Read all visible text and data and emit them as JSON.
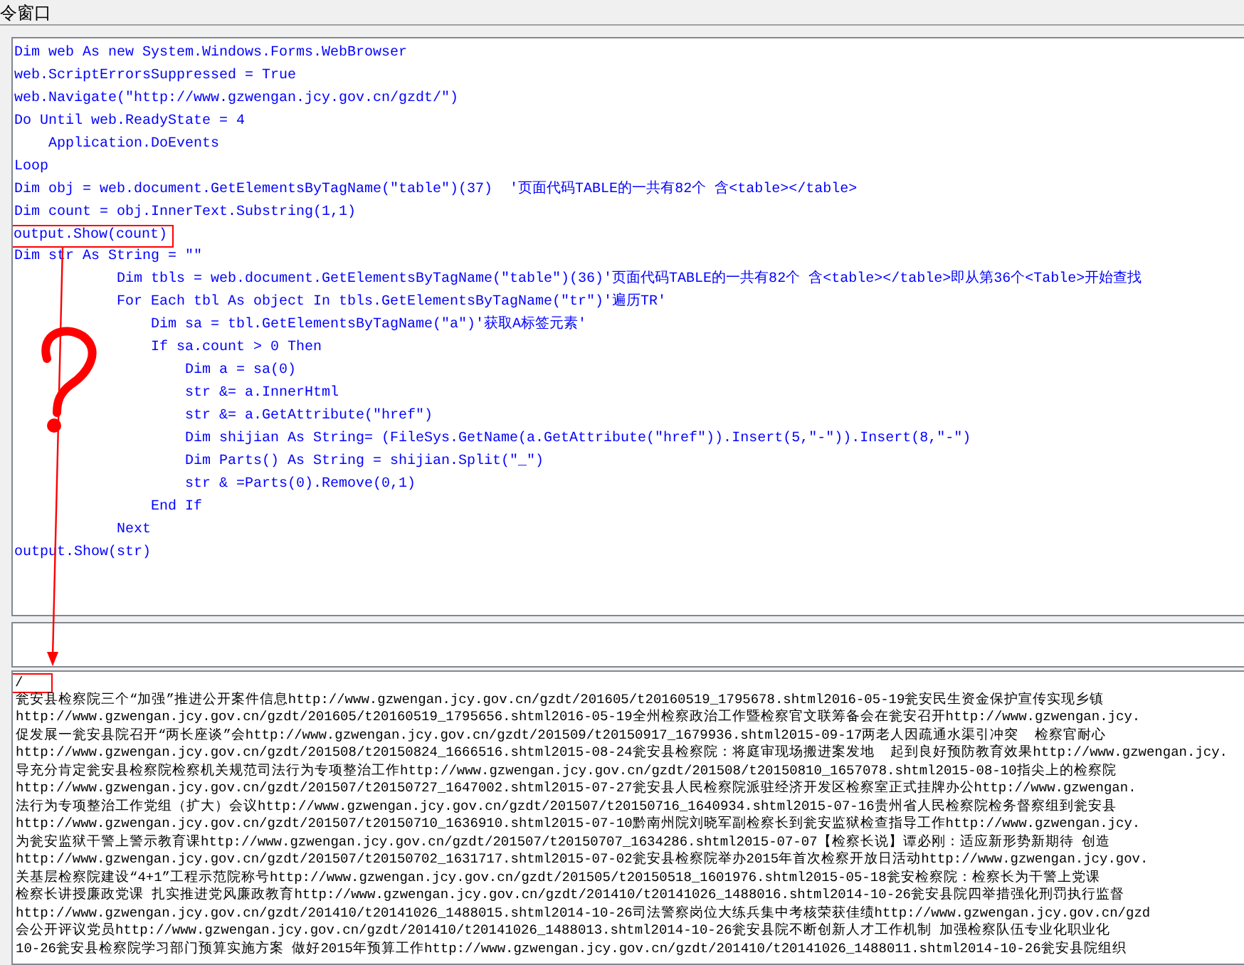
{
  "window": {
    "title": "令窗口"
  },
  "code_lines": [
    {
      "text": "Dim web As new System.Windows.Forms.WebBrowser",
      "highlighted": false
    },
    {
      "text": "web.ScriptErrorsSuppressed = True",
      "highlighted": false
    },
    {
      "text": "web.Navigate(\"http://www.gzwengan.jcy.gov.cn/gzdt/\")",
      "highlighted": false
    },
    {
      "text": "Do Until web.ReadyState = 4",
      "highlighted": false
    },
    {
      "text": "    Application.DoEvents",
      "highlighted": false
    },
    {
      "text": "Loop",
      "highlighted": false
    },
    {
      "text": "Dim obj = web.document.GetElementsByTagName(\"table\")(37)  '页面代码TABLE的一共有82个 含<table></table>",
      "highlighted": false
    },
    {
      "text": "Dim count = obj.InnerText.Substring(1,1)",
      "highlighted": false
    },
    {
      "text": "output.Show(count)",
      "highlighted": true
    },
    {
      "text": "Dim str As String = \"\"",
      "highlighted": false
    },
    {
      "text": "            Dim tbls = web.document.GetElementsByTagName(\"table\")(36)'页面代码TABLE的一共有82个 含<table></table>即从第36个<Table>开始查找",
      "highlighted": false
    },
    {
      "text": "            For Each tbl As object In tbls.GetElementsByTagName(\"tr\")'遍历TR'",
      "highlighted": false
    },
    {
      "text": "                Dim sa = tbl.GetElementsByTagName(\"a\")'获取A标签元素'",
      "highlighted": false
    },
    {
      "text": "                If sa.count > 0 Then",
      "highlighted": false
    },
    {
      "text": "                    Dim a = sa(0)",
      "highlighted": false
    },
    {
      "text": "                    str &= a.InnerHtml",
      "highlighted": false
    },
    {
      "text": "                    str &= a.GetAttribute(\"href\")",
      "highlighted": false
    },
    {
      "text": "                    Dim shijian As String= (FileSys.GetName(a.GetAttribute(\"href\")).Insert(5,\"-\")).Insert(8,\"-\")",
      "highlighted": false
    },
    {
      "text": "                    Dim Parts() As String = shijian.Split(\"_\")",
      "highlighted": false
    },
    {
      "text": "                    str & =Parts(0).Remove(0,1)",
      "highlighted": false
    },
    {
      "text": "                End If",
      "highlighted": false
    },
    {
      "text": "            Next",
      "highlighted": false
    },
    {
      "text": "output.Show(str)",
      "highlighted": false
    }
  ],
  "output_lines": [
    {
      "text": "/",
      "highlighted": true
    },
    {
      "text": "瓮安县检察院三个“加强”推进公开案件信息http://www.gzwengan.jcy.gov.cn/gzdt/201605/t20160519_1795678.shtml2016-05-19瓮安民生资金保护宣传实现乡镇",
      "highlighted": false
    },
    {
      "text": "http://www.gzwengan.jcy.gov.cn/gzdt/201605/t20160519_1795656.shtml2016-05-19全州检察政治工作暨检察官文联筹备会在瓮安召开http://www.gzwengan.jcy.",
      "highlighted": false
    },
    {
      "text": "促发展一瓮安县院召开“两长座谈”会http://www.gzwengan.jcy.gov.cn/gzdt/201509/t20150917_1679936.shtml2015-09-17两老人因疏通水渠引冲突  检察官耐心",
      "highlighted": false
    },
    {
      "text": "http://www.gzwengan.jcy.gov.cn/gzdt/201508/t20150824_1666516.shtml2015-08-24瓮安县检察院：将庭审现场搬进案发地  起到良好预防教育效果http://www.gzwengan.jcy.",
      "highlighted": false
    },
    {
      "text": "导充分肯定瓮安县检察院检察机关规范司法行为专项整治工作http://www.gzwengan.jcy.gov.cn/gzdt/201508/t20150810_1657078.shtml2015-08-10指尖上的检察院",
      "highlighted": false
    },
    {
      "text": "http://www.gzwengan.jcy.gov.cn/gzdt/201507/t20150727_1647002.shtml2015-07-27瓮安县人民检察院派驻经济开发区检察室正式挂牌办公http://www.gzwengan.",
      "highlighted": false
    },
    {
      "text": "法行为专项整治工作党组（扩大）会议http://www.gzwengan.jcy.gov.cn/gzdt/201507/t20150716_1640934.shtml2015-07-16贵州省人民检察院检务督察组到瓮安县",
      "highlighted": false
    },
    {
      "text": "http://www.gzwengan.jcy.gov.cn/gzdt/201507/t20150710_1636910.shtml2015-07-10黔南州院刘晓军副检察长到瓮安监狱检查指导工作http://www.gzwengan.jcy.",
      "highlighted": false
    },
    {
      "text": "为瓮安监狱干警上警示教育课http://www.gzwengan.jcy.gov.cn/gzdt/201507/t20150707_1634286.shtml2015-07-07【检察长说】谭必刚：适应新形势新期待 创造",
      "highlighted": false
    },
    {
      "text": "http://www.gzwengan.jcy.gov.cn/gzdt/201507/t20150702_1631717.shtml2015-07-02瓮安县检察院举办2015年首次检察开放日活动http://www.gzwengan.jcy.gov.",
      "highlighted": false
    },
    {
      "text": "关基层检察院建设“4+1”工程示范院称号http://www.gzwengan.jcy.gov.cn/gzdt/201505/t20150518_1601976.shtml2015-05-18瓮安检察院：检察长为干警上党课",
      "highlighted": false
    },
    {
      "text": "检察长讲授廉政党课 扎实推进党风廉政教育http://www.gzwengan.jcy.gov.cn/gzdt/201410/t20141026_1488016.shtml2014-10-26瓮安县院四举措强化刑罚执行监督",
      "highlighted": false
    },
    {
      "text": "http://www.gzwengan.jcy.gov.cn/gzdt/201410/t20141026_1488015.shtml2014-10-26司法警察岗位大练兵集中考核荣获佳绩http://www.gzwengan.jcy.gov.cn/gzd",
      "highlighted": false
    },
    {
      "text": "会公开评议党员http://www.gzwengan.jcy.gov.cn/gzdt/201410/t20141026_1488013.shtml2014-10-26瓮安县院不断创新人才工作机制 加强检察队伍专业化职业化",
      "highlighted": false
    },
    {
      "text": "10-26瓮安县检察院学习部门预算实施方案 做好2015年预算工作http://www.gzwengan.jcy.gov.cn/gzdt/201410/t20141026_1488011.shtml2014-10-26瓮安县院组织",
      "highlighted": false
    }
  ]
}
